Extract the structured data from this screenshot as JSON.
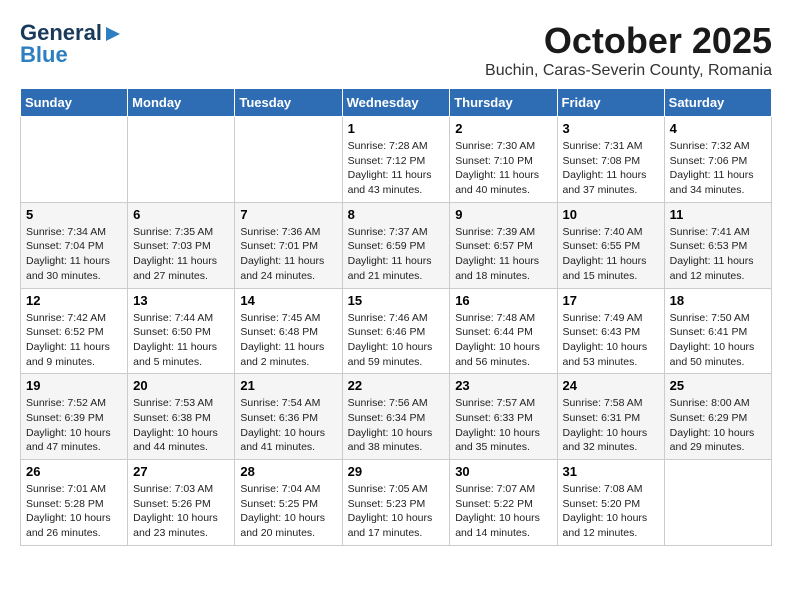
{
  "header": {
    "logo_line1": "General",
    "logo_line2": "Blue",
    "month_title": "October 2025",
    "location": "Buchin, Caras-Severin County, Romania"
  },
  "weekdays": [
    "Sunday",
    "Monday",
    "Tuesday",
    "Wednesday",
    "Thursday",
    "Friday",
    "Saturday"
  ],
  "weeks": [
    [
      {
        "day": "",
        "sunrise": "",
        "sunset": "",
        "daylight": ""
      },
      {
        "day": "",
        "sunrise": "",
        "sunset": "",
        "daylight": ""
      },
      {
        "day": "",
        "sunrise": "",
        "sunset": "",
        "daylight": ""
      },
      {
        "day": "1",
        "sunrise": "Sunrise: 7:28 AM",
        "sunset": "Sunset: 7:12 PM",
        "daylight": "Daylight: 11 hours and 43 minutes."
      },
      {
        "day": "2",
        "sunrise": "Sunrise: 7:30 AM",
        "sunset": "Sunset: 7:10 PM",
        "daylight": "Daylight: 11 hours and 40 minutes."
      },
      {
        "day": "3",
        "sunrise": "Sunrise: 7:31 AM",
        "sunset": "Sunset: 7:08 PM",
        "daylight": "Daylight: 11 hours and 37 minutes."
      },
      {
        "day": "4",
        "sunrise": "Sunrise: 7:32 AM",
        "sunset": "Sunset: 7:06 PM",
        "daylight": "Daylight: 11 hours and 34 minutes."
      }
    ],
    [
      {
        "day": "5",
        "sunrise": "Sunrise: 7:34 AM",
        "sunset": "Sunset: 7:04 PM",
        "daylight": "Daylight: 11 hours and 30 minutes."
      },
      {
        "day": "6",
        "sunrise": "Sunrise: 7:35 AM",
        "sunset": "Sunset: 7:03 PM",
        "daylight": "Daylight: 11 hours and 27 minutes."
      },
      {
        "day": "7",
        "sunrise": "Sunrise: 7:36 AM",
        "sunset": "Sunset: 7:01 PM",
        "daylight": "Daylight: 11 hours and 24 minutes."
      },
      {
        "day": "8",
        "sunrise": "Sunrise: 7:37 AM",
        "sunset": "Sunset: 6:59 PM",
        "daylight": "Daylight: 11 hours and 21 minutes."
      },
      {
        "day": "9",
        "sunrise": "Sunrise: 7:39 AM",
        "sunset": "Sunset: 6:57 PM",
        "daylight": "Daylight: 11 hours and 18 minutes."
      },
      {
        "day": "10",
        "sunrise": "Sunrise: 7:40 AM",
        "sunset": "Sunset: 6:55 PM",
        "daylight": "Daylight: 11 hours and 15 minutes."
      },
      {
        "day": "11",
        "sunrise": "Sunrise: 7:41 AM",
        "sunset": "Sunset: 6:53 PM",
        "daylight": "Daylight: 11 hours and 12 minutes."
      }
    ],
    [
      {
        "day": "12",
        "sunrise": "Sunrise: 7:42 AM",
        "sunset": "Sunset: 6:52 PM",
        "daylight": "Daylight: 11 hours and 9 minutes."
      },
      {
        "day": "13",
        "sunrise": "Sunrise: 7:44 AM",
        "sunset": "Sunset: 6:50 PM",
        "daylight": "Daylight: 11 hours and 5 minutes."
      },
      {
        "day": "14",
        "sunrise": "Sunrise: 7:45 AM",
        "sunset": "Sunset: 6:48 PM",
        "daylight": "Daylight: 11 hours and 2 minutes."
      },
      {
        "day": "15",
        "sunrise": "Sunrise: 7:46 AM",
        "sunset": "Sunset: 6:46 PM",
        "daylight": "Daylight: 10 hours and 59 minutes."
      },
      {
        "day": "16",
        "sunrise": "Sunrise: 7:48 AM",
        "sunset": "Sunset: 6:44 PM",
        "daylight": "Daylight: 10 hours and 56 minutes."
      },
      {
        "day": "17",
        "sunrise": "Sunrise: 7:49 AM",
        "sunset": "Sunset: 6:43 PM",
        "daylight": "Daylight: 10 hours and 53 minutes."
      },
      {
        "day": "18",
        "sunrise": "Sunrise: 7:50 AM",
        "sunset": "Sunset: 6:41 PM",
        "daylight": "Daylight: 10 hours and 50 minutes."
      }
    ],
    [
      {
        "day": "19",
        "sunrise": "Sunrise: 7:52 AM",
        "sunset": "Sunset: 6:39 PM",
        "daylight": "Daylight: 10 hours and 47 minutes."
      },
      {
        "day": "20",
        "sunrise": "Sunrise: 7:53 AM",
        "sunset": "Sunset: 6:38 PM",
        "daylight": "Daylight: 10 hours and 44 minutes."
      },
      {
        "day": "21",
        "sunrise": "Sunrise: 7:54 AM",
        "sunset": "Sunset: 6:36 PM",
        "daylight": "Daylight: 10 hours and 41 minutes."
      },
      {
        "day": "22",
        "sunrise": "Sunrise: 7:56 AM",
        "sunset": "Sunset: 6:34 PM",
        "daylight": "Daylight: 10 hours and 38 minutes."
      },
      {
        "day": "23",
        "sunrise": "Sunrise: 7:57 AM",
        "sunset": "Sunset: 6:33 PM",
        "daylight": "Daylight: 10 hours and 35 minutes."
      },
      {
        "day": "24",
        "sunrise": "Sunrise: 7:58 AM",
        "sunset": "Sunset: 6:31 PM",
        "daylight": "Daylight: 10 hours and 32 minutes."
      },
      {
        "day": "25",
        "sunrise": "Sunrise: 8:00 AM",
        "sunset": "Sunset: 6:29 PM",
        "daylight": "Daylight: 10 hours and 29 minutes."
      }
    ],
    [
      {
        "day": "26",
        "sunrise": "Sunrise: 7:01 AM",
        "sunset": "Sunset: 5:28 PM",
        "daylight": "Daylight: 10 hours and 26 minutes."
      },
      {
        "day": "27",
        "sunrise": "Sunrise: 7:03 AM",
        "sunset": "Sunset: 5:26 PM",
        "daylight": "Daylight: 10 hours and 23 minutes."
      },
      {
        "day": "28",
        "sunrise": "Sunrise: 7:04 AM",
        "sunset": "Sunset: 5:25 PM",
        "daylight": "Daylight: 10 hours and 20 minutes."
      },
      {
        "day": "29",
        "sunrise": "Sunrise: 7:05 AM",
        "sunset": "Sunset: 5:23 PM",
        "daylight": "Daylight: 10 hours and 17 minutes."
      },
      {
        "day": "30",
        "sunrise": "Sunrise: 7:07 AM",
        "sunset": "Sunset: 5:22 PM",
        "daylight": "Daylight: 10 hours and 14 minutes."
      },
      {
        "day": "31",
        "sunrise": "Sunrise: 7:08 AM",
        "sunset": "Sunset: 5:20 PM",
        "daylight": "Daylight: 10 hours and 12 minutes."
      },
      {
        "day": "",
        "sunrise": "",
        "sunset": "",
        "daylight": ""
      }
    ]
  ]
}
